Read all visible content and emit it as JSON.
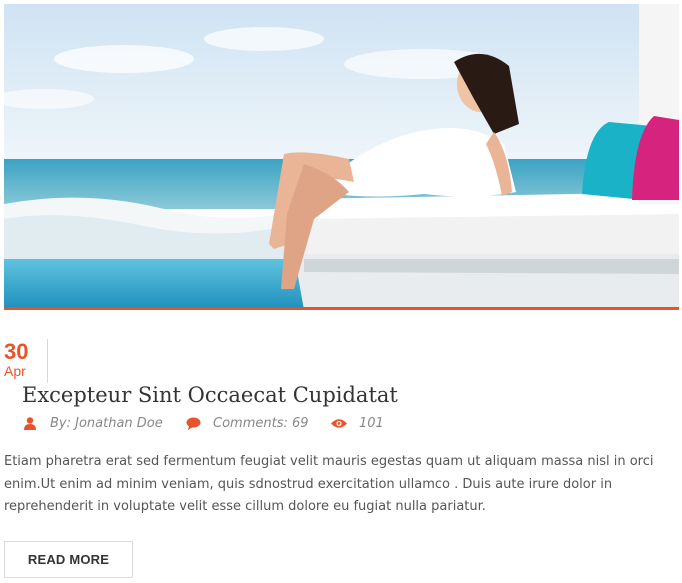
{
  "post": {
    "image_alt": "Woman in white dress relaxing on a poolside lounge bed by the sea",
    "date": {
      "day": "30",
      "month": "Apr"
    },
    "title": "Excepteur Sint Occaecat Cupidatat",
    "meta": {
      "author": "By: Jonathan Doe",
      "comments": "Comments: 69",
      "views": "101"
    },
    "excerpt": "Etiam pharetra erat sed fermentum feugiat velit mauris egestas quam ut aliquam massa nisl in orci enim.Ut enim ad minim veniam, quis sdnostrud exercitation ullamco . Duis aute irure dolor in reprehenderit in voluptate velit esse cillum dolore eu fugiat nulla pariatur.",
    "read_more_label": "READ MORE"
  },
  "icons": {
    "author": "user-icon",
    "comments": "comment-icon",
    "views": "eye-icon"
  },
  "colors": {
    "accent": "#e8532c",
    "title": "#333333",
    "meta": "#888888",
    "body": "#555555"
  }
}
